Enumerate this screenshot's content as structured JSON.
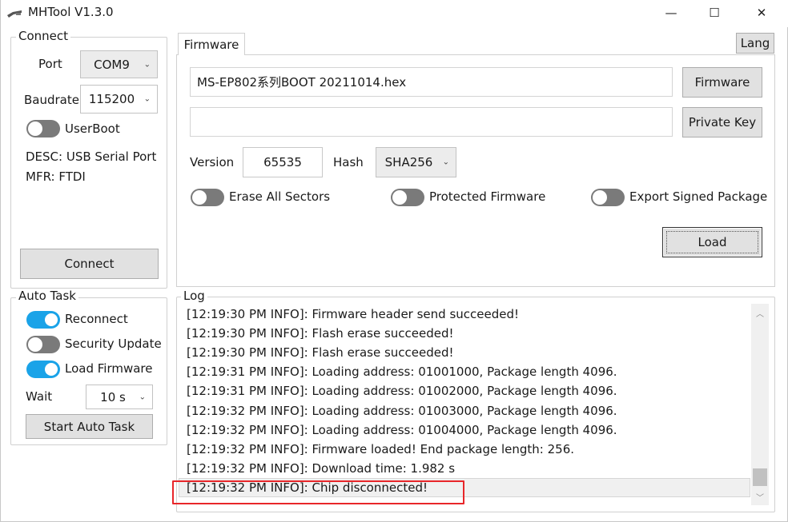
{
  "window": {
    "title": "MHTool V1.3.0",
    "min_glyph": "—",
    "max_glyph": "☐",
    "close_glyph": "✕",
    "icons": [
      "tool-icon",
      "minimize-icon",
      "maximize-icon",
      "close-icon"
    ]
  },
  "connect": {
    "legend": "Connect",
    "port_label": "Port",
    "port_value": "COM9",
    "baudrate_label": "Baudrate",
    "baudrate_value": "115200",
    "userboot_label": "UserBoot",
    "userboot_on": false,
    "desc": "DESC: USB Serial Port",
    "mfr": "MFR: FTDI",
    "connect_button": "Connect"
  },
  "auto_task": {
    "legend": "Auto Task",
    "reconnect_label": "Reconnect",
    "reconnect_on": true,
    "security_update_label": "Security Update",
    "security_update_on": false,
    "load_firmware_label": "Load Firmware",
    "load_firmware_on": true,
    "wait_label": "Wait",
    "wait_value": "10 s",
    "start_button": "Start Auto Task"
  },
  "firmware": {
    "tab_label": "Firmware",
    "lang_button": "Lang",
    "file_path": "MS-EP802系列BOOT 20211014.hex",
    "firmware_button": "Firmware",
    "private_key_value": "",
    "private_key_button": "Private Key",
    "version_label": "Version",
    "version_value": "65535",
    "hash_label": "Hash",
    "hash_value": "SHA256",
    "erase_all_label": "Erase All Sectors",
    "erase_all_on": false,
    "protected_label": "Protected Firmware",
    "protected_on": false,
    "export_signed_label": "Export Signed Package",
    "export_signed_on": false,
    "load_button": "Load"
  },
  "log": {
    "legend": "Log",
    "lines": [
      "[12:19:30 PM INFO]: Firmware header send succeeded!",
      "[12:19:30 PM INFO]: Flash erase succeeded!",
      "[12:19:30 PM INFO]: Flash erase succeeded!",
      "[12:19:31 PM INFO]: Loading address: 01001000, Package length 4096.",
      "[12:19:31 PM INFO]: Loading address: 01002000, Package length 4096.",
      "[12:19:32 PM INFO]: Loading address: 01003000, Package length 4096.",
      "[12:19:32 PM INFO]: Loading address: 01004000, Package length 4096.",
      "[12:19:32 PM INFO]: Firmware loaded! End package length: 256.",
      "[12:19:32 PM INFO]: Download time: 1.982 s",
      "[12:19:32 PM INFO]: Chip disconnected!"
    ],
    "selected_index": 9,
    "highlight_color": "#e8262a"
  },
  "colors": {
    "toggle_on": "#1aa3e8",
    "button_bg": "#e1e1e1"
  }
}
